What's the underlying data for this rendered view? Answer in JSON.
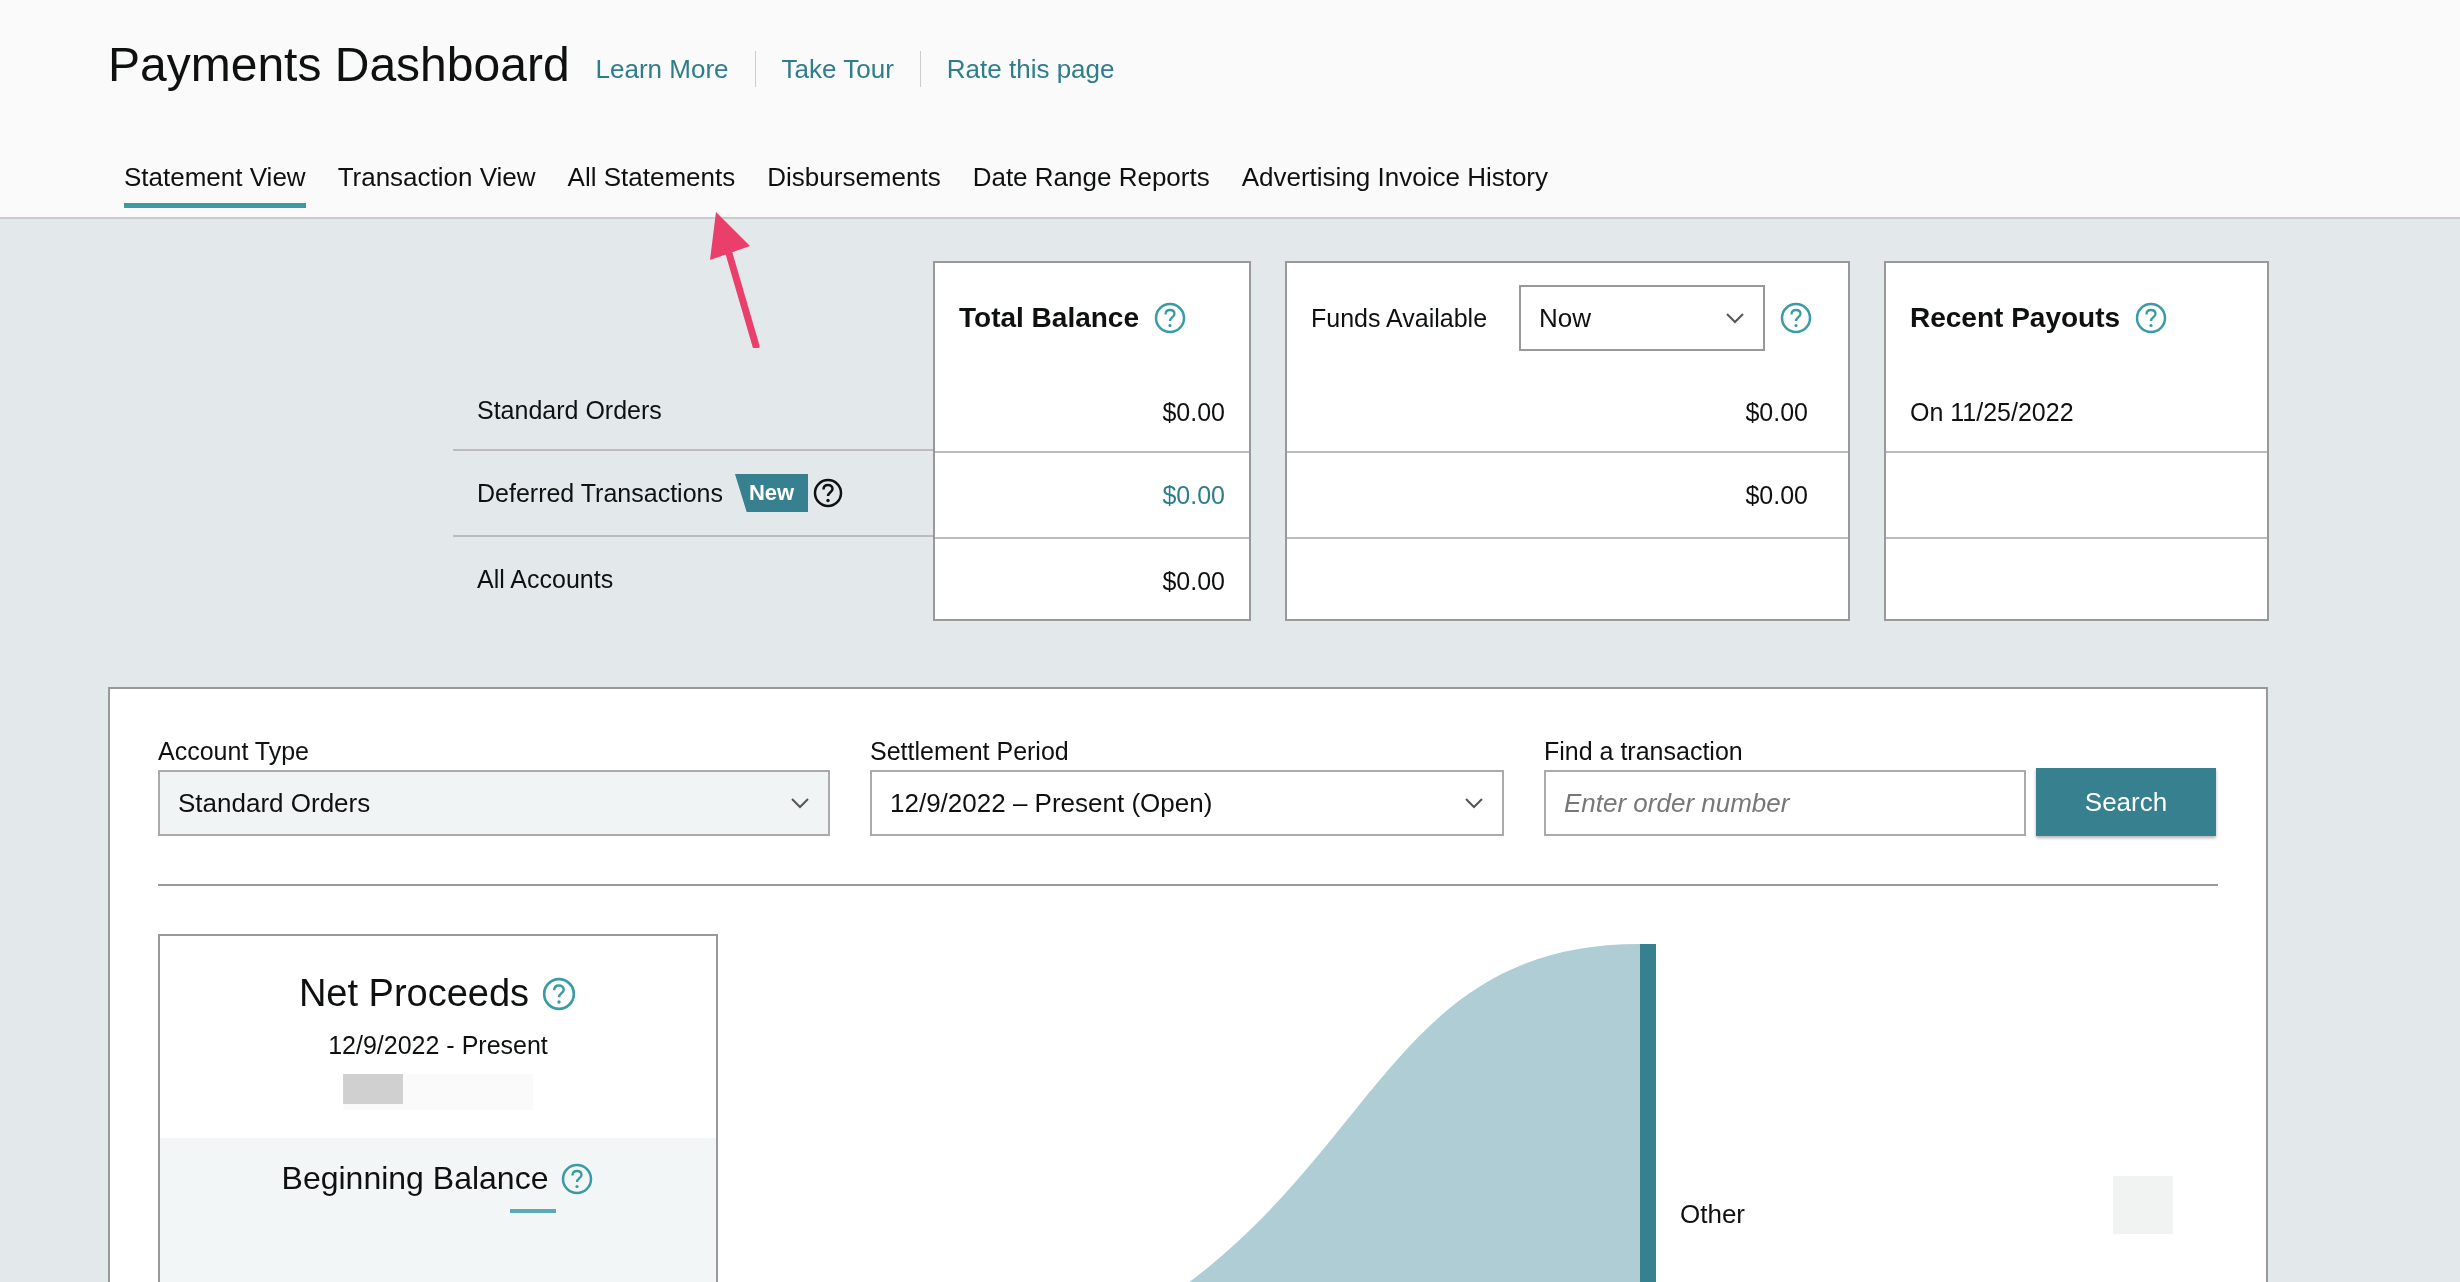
{
  "header": {
    "title": "Payments Dashboard",
    "links": [
      "Learn More",
      "Take Tour",
      "Rate this page"
    ]
  },
  "tabs": [
    {
      "label": "Statement View",
      "selected": true
    },
    {
      "label": "Transaction View",
      "selected": false
    },
    {
      "label": "All Statements",
      "selected": false
    },
    {
      "label": "Disbursements",
      "selected": false
    },
    {
      "label": "Date Range Reports",
      "selected": false
    },
    {
      "label": "Advertising Invoice History",
      "selected": false
    }
  ],
  "balance_rows": [
    {
      "label": "Standard Orders"
    },
    {
      "label": "Deferred Transactions",
      "badge": "New"
    },
    {
      "label": "All Accounts"
    }
  ],
  "balance_cards": [
    {
      "kind": "title",
      "title": "Total Balance",
      "values": [
        {
          "text": "$0.00",
          "link": false
        },
        {
          "text": "$0.00",
          "link": true
        },
        {
          "text": "$0.00",
          "link": false
        }
      ]
    },
    {
      "kind": "dropdown",
      "title": "Funds Available",
      "dropdown": "Now",
      "values": [
        {
          "text": "$0.00",
          "link": false
        },
        {
          "text": "$0.00",
          "link": false
        }
      ]
    },
    {
      "kind": "title",
      "title": "Recent Payouts",
      "values": [
        {
          "text": "On 11/25/2022",
          "link": false
        }
      ]
    }
  ],
  "filters": {
    "account_type": {
      "label": "Account Type",
      "value": "Standard Orders"
    },
    "settlement_period": {
      "label": "Settlement Period",
      "value": "12/9/2022 – Present (Open)"
    },
    "find": {
      "label": "Find a transaction",
      "placeholder": "Enter order number"
    },
    "search_button": "Search"
  },
  "net_proceeds": {
    "title": "Net Proceeds",
    "period": "12/9/2022 - Present",
    "section_title": "Beginning Balance"
  },
  "flow": {
    "legend": "Other"
  }
}
